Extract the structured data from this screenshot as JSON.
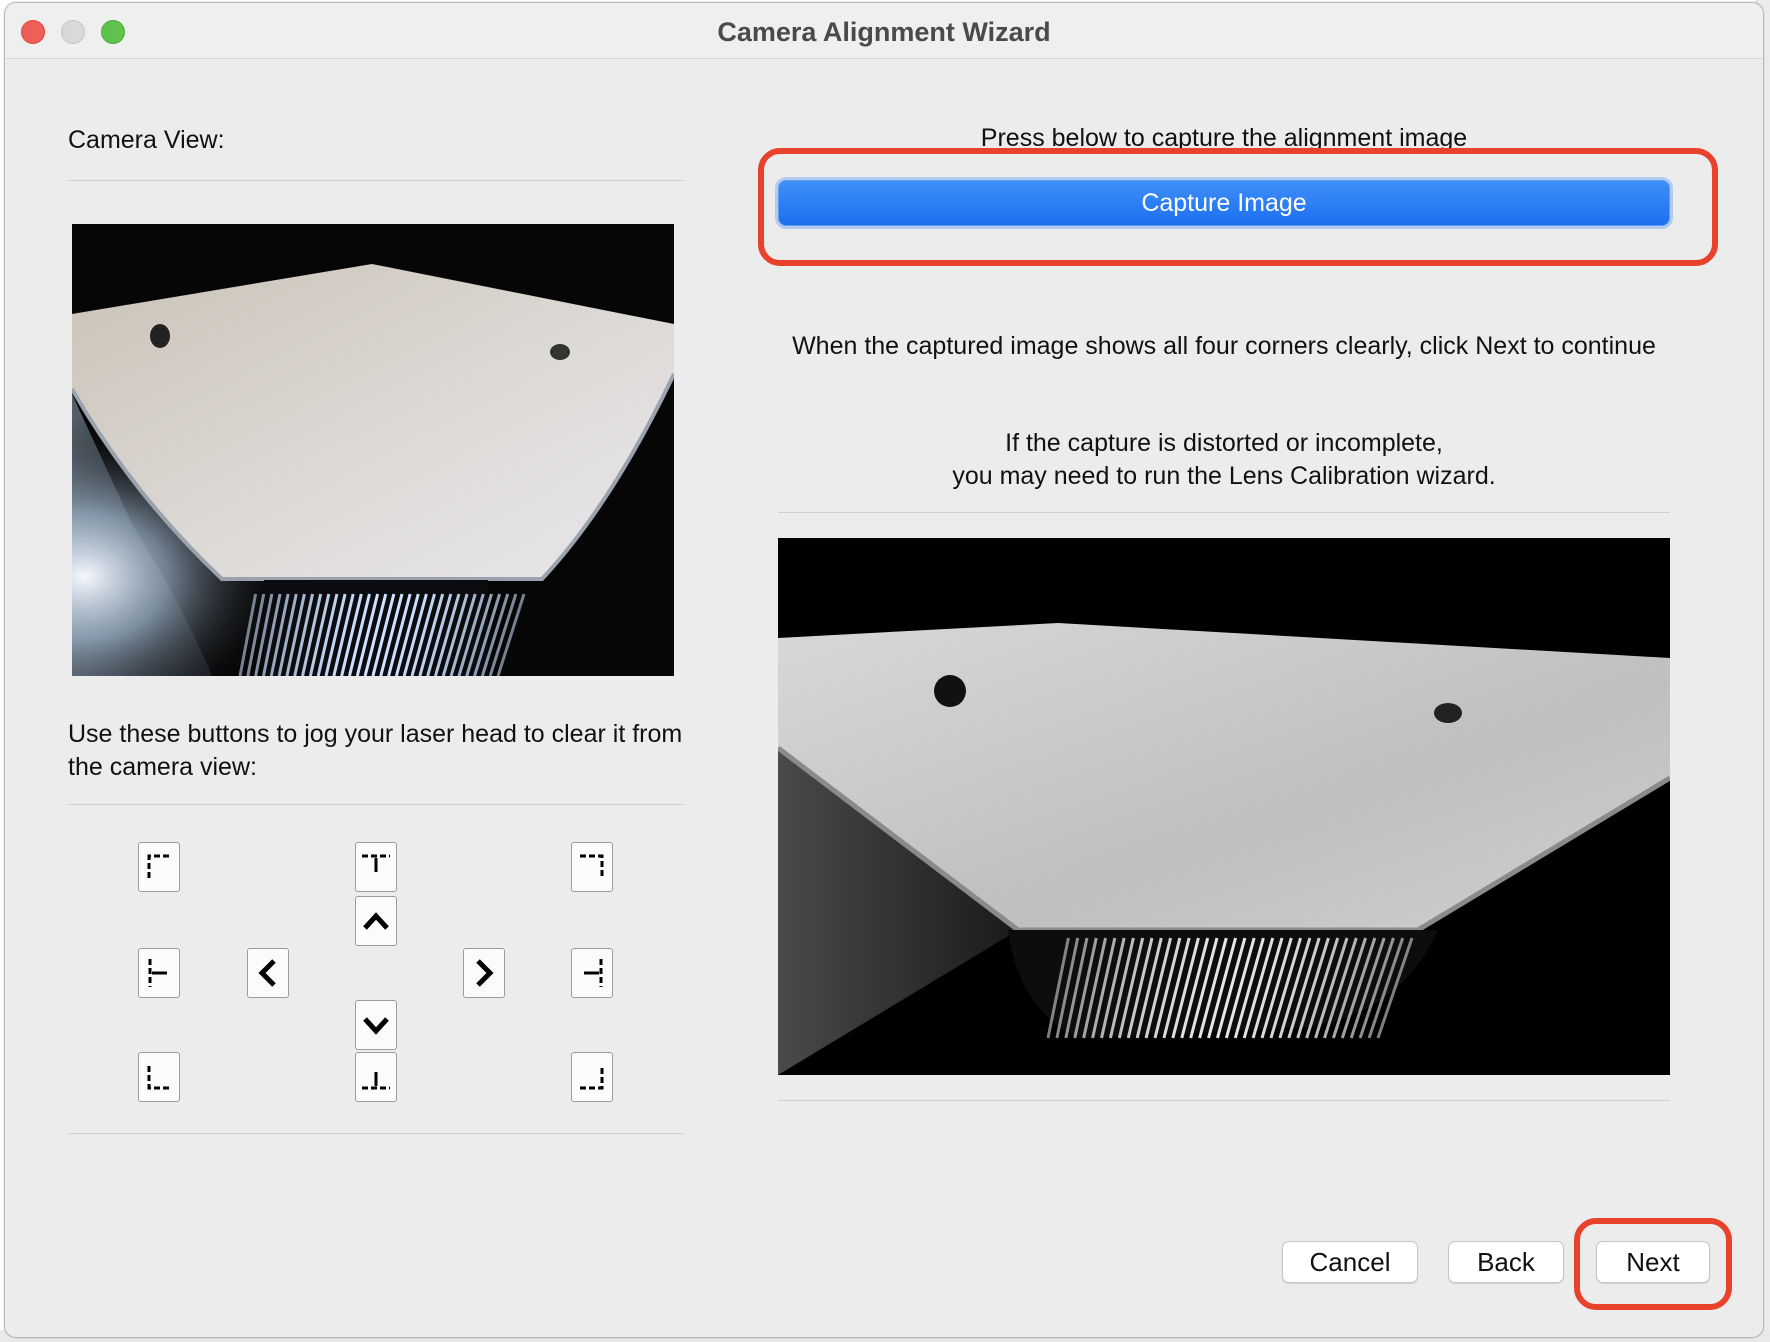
{
  "window": {
    "title": "Camera Alignment Wizard"
  },
  "left_panel": {
    "camera_view_label": "Camera View:",
    "jog_instructions": "Use these buttons to jog your laser head to clear it from the camera view:",
    "jog_buttons": [
      {
        "name": "jog-top-left-corner",
        "icon": "corner-top-left-icon"
      },
      {
        "name": "jog-top-center-edge",
        "icon": "edge-top-icon"
      },
      {
        "name": "jog-top-right-corner",
        "icon": "corner-top-right-icon"
      },
      {
        "name": "jog-up",
        "icon": "chevron-up-icon"
      },
      {
        "name": "jog-left-center-edge",
        "icon": "edge-left-icon"
      },
      {
        "name": "jog-left",
        "icon": "chevron-left-icon"
      },
      {
        "name": "jog-right",
        "icon": "chevron-right-icon"
      },
      {
        "name": "jog-right-center-edge",
        "icon": "edge-right-icon"
      },
      {
        "name": "jog-down",
        "icon": "chevron-down-icon"
      },
      {
        "name": "jog-bottom-left-corner",
        "icon": "corner-bottom-left-icon"
      },
      {
        "name": "jog-bottom-center-edge",
        "icon": "edge-bottom-icon"
      },
      {
        "name": "jog-bottom-right-corner",
        "icon": "corner-bottom-right-icon"
      }
    ]
  },
  "right_panel": {
    "capture_prompt": "Press below to capture the alignment image",
    "capture_button_label": "Capture Image",
    "next_instruction": "When the captured image shows all four corners clearly, click Next to continue",
    "distortion_line1": "If the capture is distorted or incomplete,",
    "distortion_line2": "you may need to run the Lens Calibration wizard."
  },
  "footer": {
    "cancel_label": "Cancel",
    "back_label": "Back",
    "next_label": "Next"
  },
  "colors": {
    "accent": "#2a7ff3",
    "highlight": "#e8412c",
    "window_bg": "#ececec"
  }
}
